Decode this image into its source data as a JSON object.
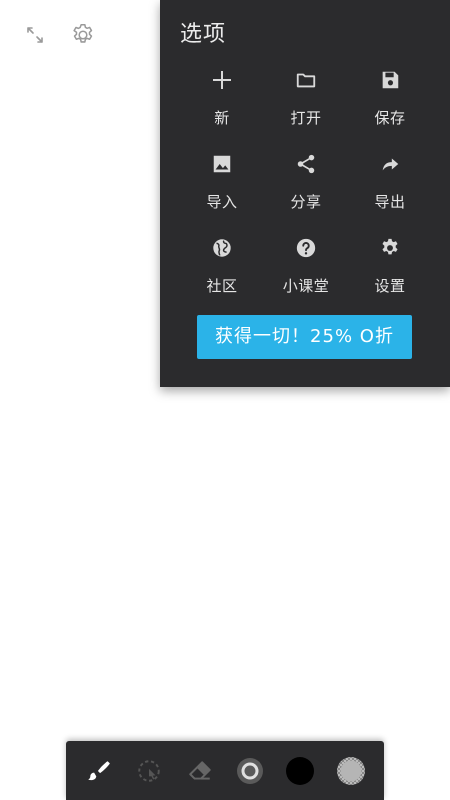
{
  "canvas_controls": {
    "fullscreen_icon": "collapse-icon",
    "settings_icon": "gear-icon"
  },
  "options_menu": {
    "title": "选项",
    "items": [
      {
        "label": "新",
        "icon": "plus-icon"
      },
      {
        "label": "打开",
        "icon": "folder-icon"
      },
      {
        "label": "保存",
        "icon": "save-icon"
      },
      {
        "label": "导入",
        "icon": "image-icon"
      },
      {
        "label": "分享",
        "icon": "share-icon"
      },
      {
        "label": "导出",
        "icon": "forward-arrow-icon"
      },
      {
        "label": "社区",
        "icon": "globe-icon"
      },
      {
        "label": "小课堂",
        "icon": "help-icon"
      },
      {
        "label": "设置",
        "icon": "gear-icon"
      }
    ],
    "promo_label": "获得一切！25% O折"
  },
  "toolbar": {
    "tools": [
      {
        "name": "brush-tool",
        "icon": "brush-icon",
        "active": true
      },
      {
        "name": "selection-tool",
        "icon": "lasso-select-icon",
        "active": false
      },
      {
        "name": "eraser-tool",
        "icon": "eraser-icon",
        "active": false
      },
      {
        "name": "brush-size",
        "icon": "ring-icon",
        "active": false
      },
      {
        "name": "color-picker",
        "icon": "color-swatch-icon",
        "active": false
      },
      {
        "name": "opacity",
        "icon": "opacity-icon",
        "active": false
      }
    ],
    "current_color": "#000000"
  },
  "colors": {
    "panel_bg": "#2b2b2d",
    "accent": "#2bb3e8",
    "icon_light": "#d9d9d9"
  }
}
